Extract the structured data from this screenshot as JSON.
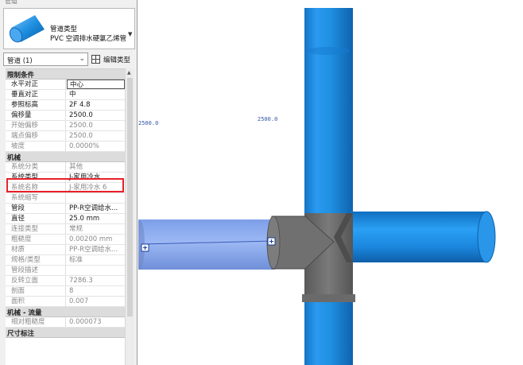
{
  "panel": {
    "title": "管道",
    "type_category": "管道类型",
    "type_name": "PVC 空调排水硬氯乙烯管",
    "instance_label": "管道 (1)",
    "edit_type_label": "编辑类型"
  },
  "sections": {
    "constraints": "限制条件",
    "mechanical": "机械",
    "mechanical_flow": "机械 - 流量",
    "dimensions": "尺寸标注"
  },
  "constraints_rows": [
    {
      "name": "水平对正",
      "value": "中心"
    },
    {
      "name": "垂直对正",
      "value": "中"
    },
    {
      "name": "参照标高",
      "value": "2F   4.8"
    },
    {
      "name": "偏移量",
      "value": "2500.0"
    },
    {
      "name": "开始偏移",
      "value": "2500.0"
    },
    {
      "name": "端点偏移",
      "value": "2500.0"
    },
    {
      "name": "坡度",
      "value": "0.0000%"
    }
  ],
  "mechanical_rows": [
    {
      "name": "系统分类",
      "value": "其他"
    },
    {
      "name": "系统类型",
      "value": "J-家用冷水"
    },
    {
      "name": "系统名称",
      "value": "J-家用冷水 6"
    },
    {
      "name": "系统缩写",
      "value": ""
    },
    {
      "name": "管段",
      "value": "PP-R空调给水..."
    },
    {
      "name": "直径",
      "value": "25.0 mm"
    },
    {
      "name": "连接类型",
      "value": "常规"
    },
    {
      "name": "粗糙度",
      "value": "0.00200 mm"
    },
    {
      "name": "材质",
      "value": "PP-R空调给水..."
    },
    {
      "name": "规格/类型",
      "value": "标准"
    },
    {
      "name": "管段描述",
      "value": ""
    },
    {
      "name": "反转立面",
      "value": "7286.3"
    },
    {
      "name": "剖面",
      "value": "8"
    },
    {
      "name": "面积",
      "value": "0.007"
    }
  ],
  "flow_rows": [
    {
      "name": "相对粗糙度",
      "value": "0.000073"
    }
  ],
  "viewport": {
    "dim_left": "2500.0",
    "dim_right": "2500.0"
  },
  "colors": {
    "highlight": "#e8202a",
    "pipe_blue": "#1e8fe0",
    "pipe_selected": "#8fb0f0",
    "fitting_gray": "#6e6e6e"
  }
}
